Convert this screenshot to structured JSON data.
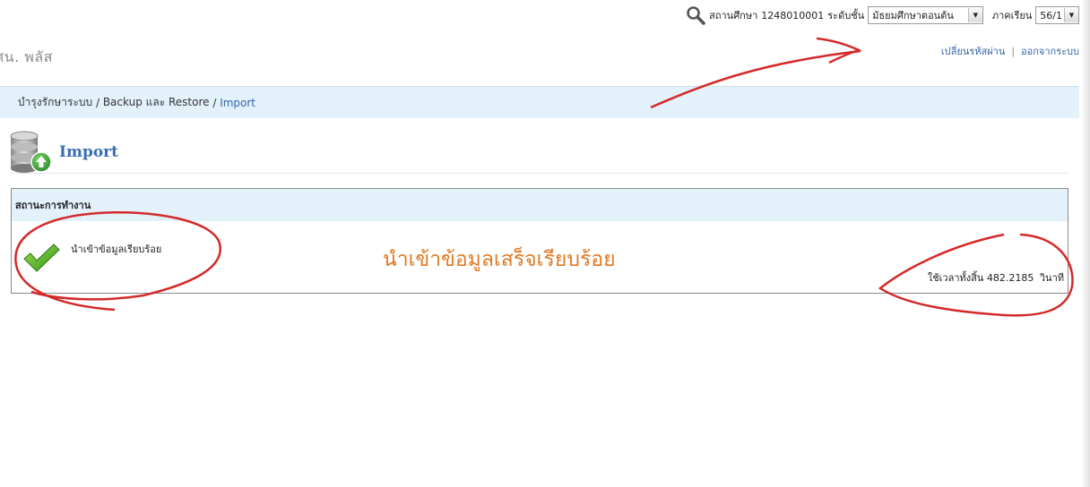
{
  "header": {
    "school_label": "สถานศึกษา",
    "school_code": "1248010001",
    "level_label": "ระดับชั้น",
    "level_value": "มัธยมศึกษาตอนต้น",
    "term_label": "ภาคเรียน",
    "term_value": "56/1",
    "change_password": "เปลี่ยนรหัสผ่าน",
    "separator": "|",
    "logout": "ออกจากระบบ",
    "app_name": "ศน. พลัส"
  },
  "breadcrumb": {
    "part1": "บำรุงรักษาระบบ",
    "sep1": " / ",
    "part2": "Backup และ Restore",
    "sep2": " / ",
    "current": "Import"
  },
  "page": {
    "title": "Import"
  },
  "status": {
    "header": "สถานะการทำงาน",
    "message": "นำเข้าข้อมูลเรียบร้อย",
    "elapsed_label": "ใช้เวลาทั้งสิ้น",
    "elapsed_value": "482.2185",
    "elapsed_unit": "วินาที"
  },
  "annotation": {
    "text": "นำเข้าข้อมูลเสร็จเรียบร้อย",
    "text_color": "#e07a22",
    "mark_color": "#d42a2a"
  },
  "icons": [
    "search-icon",
    "dropdown-arrow-icon",
    "database-upload-icon",
    "check-icon"
  ]
}
